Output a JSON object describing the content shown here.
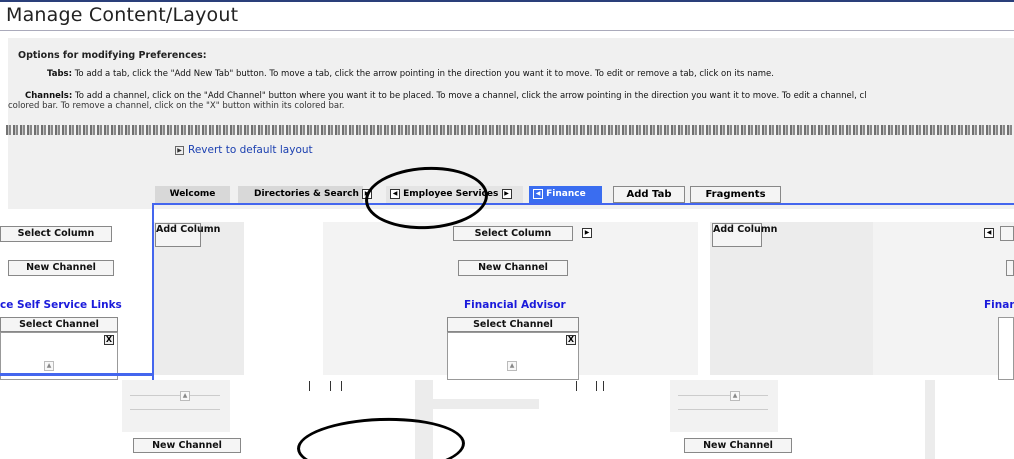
{
  "page": {
    "title": "Manage Content/Layout"
  },
  "preferences": {
    "heading": "Options for modifying Preferences:",
    "tabs_label": "Tabs:",
    "tabs_text": "To add a tab, click the \"Add New Tab\" button. To move a tab, click the arrow pointing in the direction you want it to move. To edit or remove a tab, click on its name.",
    "channels_label": "Channels:",
    "channels_text": "To add a channel, click on the \"Add Channel\" button where you want it to be placed. To move a channel, click the arrow pointing in the direction you want it to move. To edit a channel, cl",
    "channels_text_2": "colored bar. To remove a channel, click on the \"X\" button within its colored bar."
  },
  "revert_link": "Revert to default layout",
  "tabs": [
    {
      "label": "Welcome"
    },
    {
      "label": "Directories & Search"
    },
    {
      "label": "Employee Services"
    },
    {
      "label": "Finance"
    }
  ],
  "tab_buttons": {
    "add_tab": "Add Tab",
    "fragments": "Fragments"
  },
  "columns": {
    "select_column": "Select Column",
    "add_column": "Add Column",
    "new_channel": "New Channel",
    "select_channel": "Select Channel",
    "remove_glyph": "X"
  },
  "channels": [
    {
      "title": "ce Self Service Links"
    },
    {
      "title": "Financial Advisor"
    },
    {
      "title": "Finan"
    }
  ],
  "colors": {
    "frame_blue": "#4466ee",
    "active_tab": "#3a6df0",
    "channel_title": "#1a1adb",
    "link": "#1a3fb0"
  },
  "icons": [
    "arrow-left-icon",
    "arrow-right-icon",
    "close-icon",
    "triangle-bullet-icon"
  ]
}
